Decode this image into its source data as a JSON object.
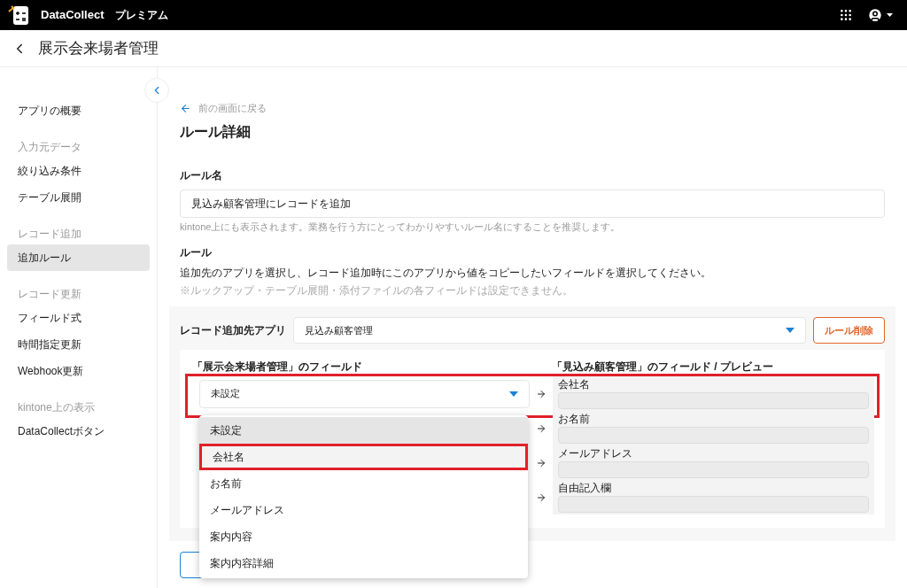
{
  "header": {
    "brand": "DataCollect",
    "plan": "プレミアム"
  },
  "page_title": "展示会来場者管理",
  "sidebar": {
    "sections": [
      {
        "items": [
          {
            "label": "アプリの概要",
            "selected": false
          }
        ]
      },
      {
        "heading": "入力元データ",
        "items": [
          {
            "label": "絞り込み条件",
            "selected": false
          },
          {
            "label": "テーブル展開",
            "selected": false
          }
        ]
      },
      {
        "heading": "レコード追加",
        "items": [
          {
            "label": "追加ルール",
            "selected": true
          }
        ]
      },
      {
        "heading": "レコード更新",
        "items": [
          {
            "label": "フィールド式",
            "selected": false
          },
          {
            "label": "時間指定更新",
            "selected": false
          },
          {
            "label": "Webhook更新",
            "selected": false
          }
        ]
      },
      {
        "heading": "kintone上の表示",
        "items": [
          {
            "label": "DataCollectボタン",
            "selected": false
          }
        ]
      }
    ]
  },
  "back_link": "前の画面に戻る",
  "heading": "ルール詳細",
  "rule_name": {
    "label": "ルール名",
    "value": "見込み顧客管理にレコードを追加",
    "hint": "kintone上にも表示されます。業務を行う方にとってわかりやすいルール名にすることを推奨します。"
  },
  "rule": {
    "label": "ルール",
    "description": "追加先のアプリを選択し、レコード追加時にこのアプリから値をコピーしたいフィールドを選択してください。",
    "note": "※ルックアップ・テーブル展開・添付ファイルの各フィールドは設定できません。"
  },
  "target_app": {
    "label": "レコード追加先アプリ",
    "value": "見込み顧客管理",
    "delete_button": "ルール削除"
  },
  "mapping": {
    "source_heading": "「展示会来場者管理」のフィールド",
    "target_heading": "「見込み顧客管理」のフィールド / プレビュー",
    "rows": [
      {
        "source": "未設定",
        "target": "会社名",
        "highlighted": true
      },
      {
        "source": null,
        "target": "お名前",
        "highlighted": false
      },
      {
        "source": null,
        "target": "メールアドレス",
        "highlighted": false
      },
      {
        "source": null,
        "target": "自由記入欄",
        "highlighted": false
      }
    ]
  },
  "dropdown_options": [
    {
      "label": "未設定",
      "selected": true,
      "highlighted": false
    },
    {
      "label": "会社名",
      "selected": false,
      "highlighted": true
    },
    {
      "label": "お名前",
      "selected": false,
      "highlighted": false
    },
    {
      "label": "メールアドレス",
      "selected": false,
      "highlighted": false
    },
    {
      "label": "案内内容",
      "selected": false,
      "highlighted": false
    },
    {
      "label": "案内内容詳細",
      "selected": false,
      "highlighted": false
    }
  ]
}
